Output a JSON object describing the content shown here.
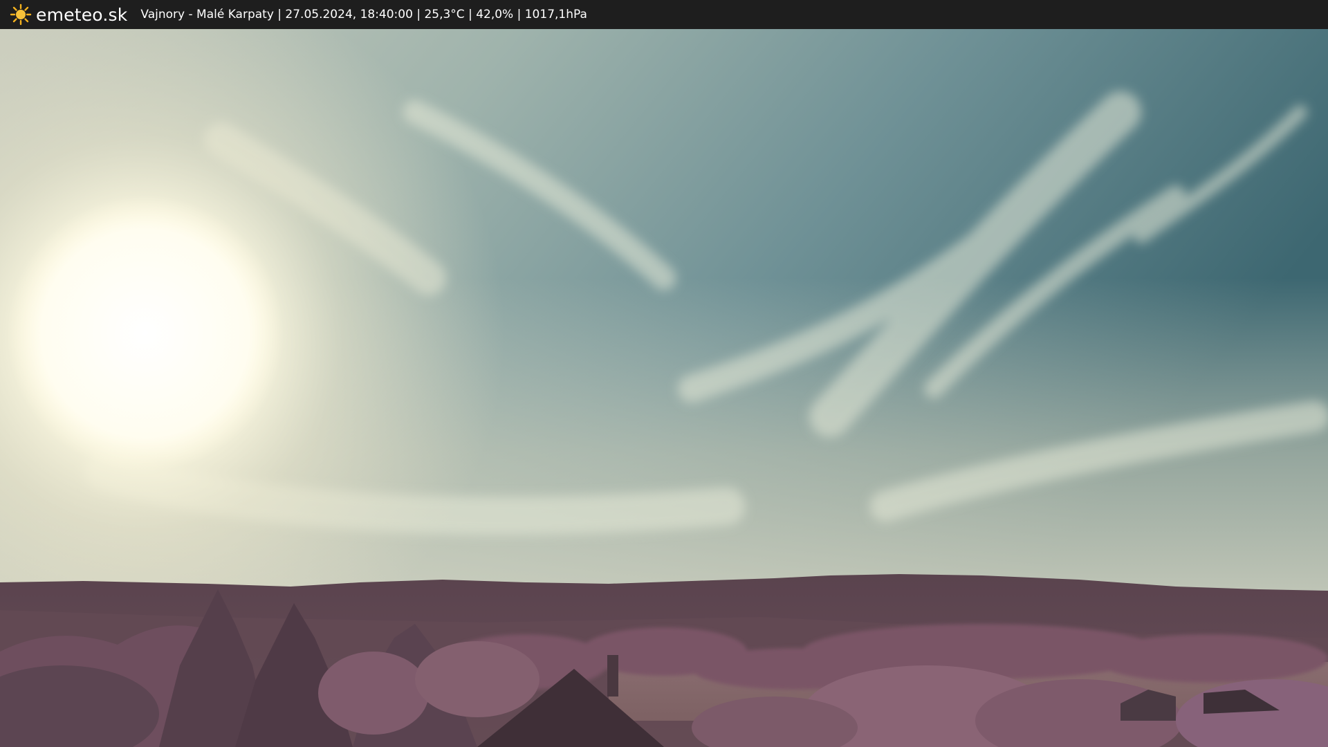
{
  "header": {
    "logo_text": "emeteo.sk",
    "logo_icon": "sun-icon",
    "caption": "Vajnory - Malé Karpaty | 27.05.2024, 18:40:00 | 25,3°C | 42,0% | 1017,1hPa"
  },
  "colors": {
    "bar": "#1e1e1e",
    "sun": "#f5b21d",
    "sky_top": "#3f6b73",
    "sky_haze": "#d6dcc6",
    "ridge": "#5c4650",
    "foliage": "#7a5566"
  }
}
